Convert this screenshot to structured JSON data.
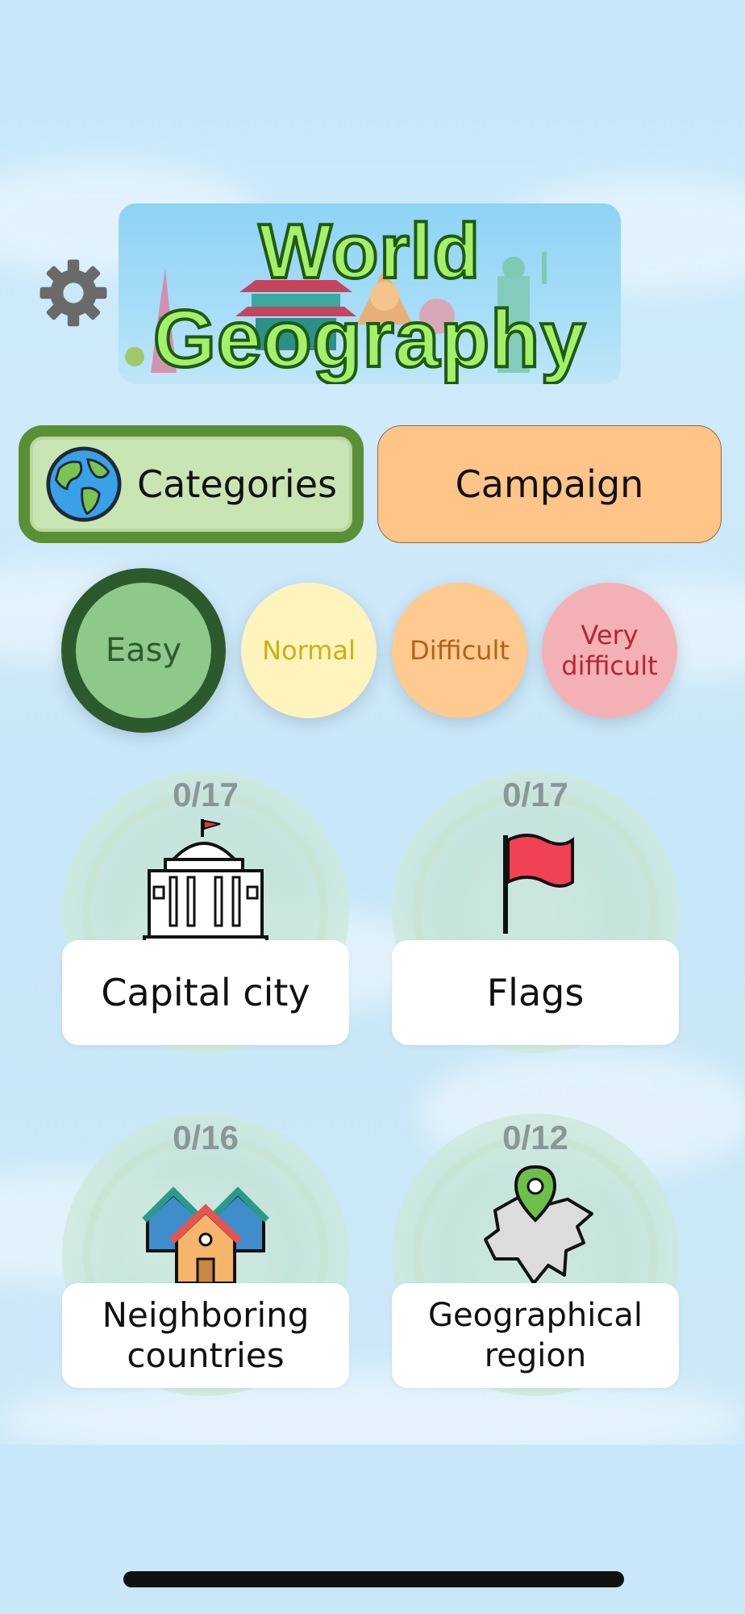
{
  "app": {
    "title_line1": "World",
    "title_line2": "Geography"
  },
  "settings": {
    "icon": "gear-icon"
  },
  "modes": {
    "categories_label": "Categories",
    "campaign_label": "Campaign",
    "selected": "Categories"
  },
  "difficulty": {
    "selected": "Easy",
    "levels": [
      {
        "label": "Easy"
      },
      {
        "label": "Normal"
      },
      {
        "label": "Difficult"
      },
      {
        "label": "Very difficult"
      }
    ]
  },
  "categories": [
    {
      "progress": "0/17",
      "label": "Capital city",
      "icon": "capitol-building-icon"
    },
    {
      "progress": "0/17",
      "label": "Flags",
      "icon": "red-flag-icon"
    },
    {
      "progress": "0/16",
      "label": "Neighboring countries",
      "icon": "houses-icon"
    },
    {
      "progress": "0/12",
      "label": "Geographical region",
      "icon": "map-pin-region-icon"
    }
  ],
  "colors": {
    "easy": "#8fc98a",
    "normal": "#fff4be",
    "difficult": "#ffca8f",
    "very_difficult": "#f3b1b6",
    "campaign": "#ffc488",
    "categories": "#c9e5b4"
  }
}
